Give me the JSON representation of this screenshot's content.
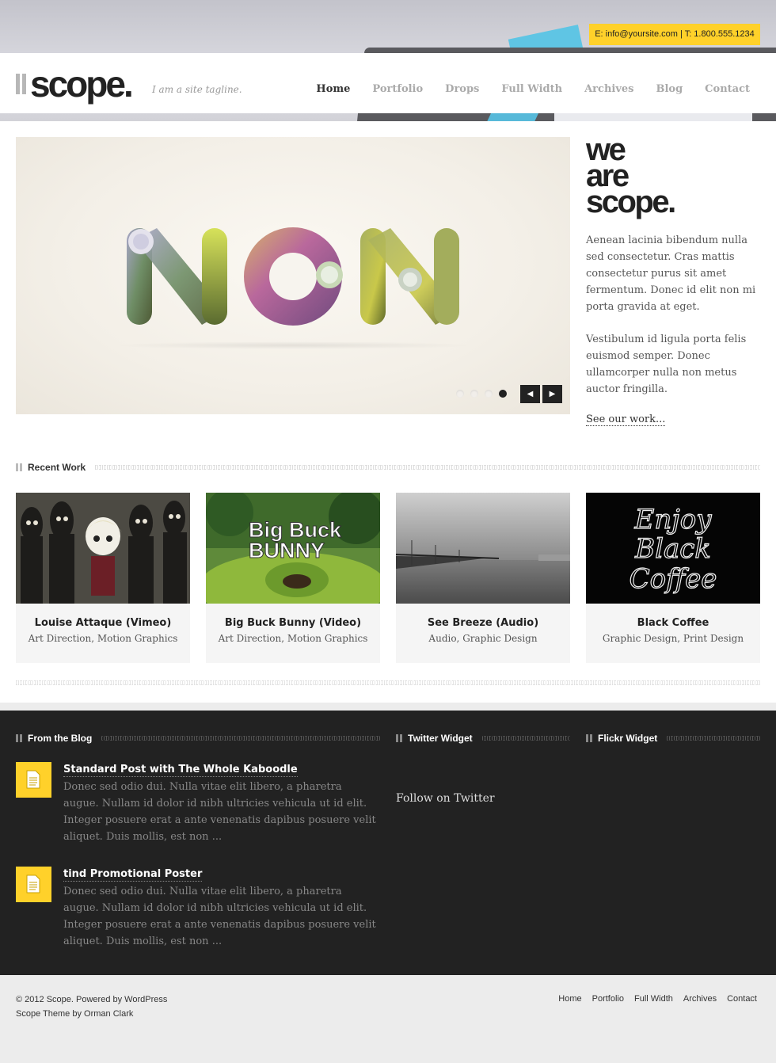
{
  "contact_bar": "E: info@yoursite.com | T: 1.800.555.1234",
  "logo": {
    "text": "scope."
  },
  "tagline": "I am a site tagline.",
  "nav": [
    {
      "label": "Home"
    },
    {
      "label": "Portfolio"
    },
    {
      "label": "Drops"
    },
    {
      "label": "Full Width"
    },
    {
      "label": "Archives"
    },
    {
      "label": "Blog"
    },
    {
      "label": "Contact"
    }
  ],
  "slider": {
    "word": "NON",
    "slide_count": 4,
    "active_slide": 4,
    "prev_icon": "chevron-left-icon",
    "next_icon": "chevron-right-icon"
  },
  "intro": {
    "headline": [
      "we",
      "are",
      "scope."
    ],
    "para1": "Aenean lacinia bibendum nulla sed consectetur. Cras mattis consectetur purus sit amet fermentum. Donec id elit non mi porta gravida at eget.",
    "para2": "Vestibulum id ligula porta felis euismod semper. Donec ullamcorper nulla non metus auctor fringilla.",
    "link": "See our work..."
  },
  "recent_work": {
    "title": "Recent Work",
    "items": [
      {
        "title": "Louise Attaque (Vimeo)",
        "cats": "Art Direction, Motion Graphics"
      },
      {
        "title": "Big Buck Bunny (Video)",
        "cats": "Art Direction, Motion Graphics"
      },
      {
        "title": "See Breeze (Audio)",
        "cats": "Audio, Graphic Design"
      },
      {
        "title": "Black Coffee",
        "cats": "Graphic Design, Print Design"
      }
    ]
  },
  "thumb_text": {
    "bunny": [
      "Big Buck",
      "BUNNY"
    ],
    "coffee": [
      "Enjoy",
      "Black",
      "Coffee"
    ]
  },
  "blog": {
    "title": "From the Blog",
    "posts": [
      {
        "title": "Standard Post with The Whole Kaboodle",
        "excerpt": "Donec sed odio dui. Nulla vitae elit libero, a pharetra augue. Nullam id dolor id nibh ultricies vehicula ut id elit. Integer posuere erat a ante venenatis dapibus posuere velit aliquet. Duis mollis, est non ..."
      },
      {
        "title": "tind Promotional Poster",
        "excerpt": "Donec sed odio dui. Nulla vitae elit libero, a pharetra augue. Nullam id dolor id nibh ultricies vehicula ut id elit. Integer posuere erat a ante venenatis dapibus posuere velit aliquet. Duis mollis, est non ..."
      }
    ]
  },
  "twitter": {
    "title": "Twitter Widget",
    "follow": "Follow on Twitter"
  },
  "flickr": {
    "title": "Flickr Widget"
  },
  "footer": {
    "copy_prefix": "© 2012",
    "site": "Scope",
    "powered": ". Powered by",
    "wp": "WordPress",
    "theme": "Scope Theme",
    "by": "by",
    "author": "Orman Clark",
    "links": [
      "Home",
      "Portfolio",
      "Full Width",
      "Archives",
      "Contact"
    ]
  },
  "colors": {
    "accent": "#ffd12a",
    "dark": "#222222"
  }
}
